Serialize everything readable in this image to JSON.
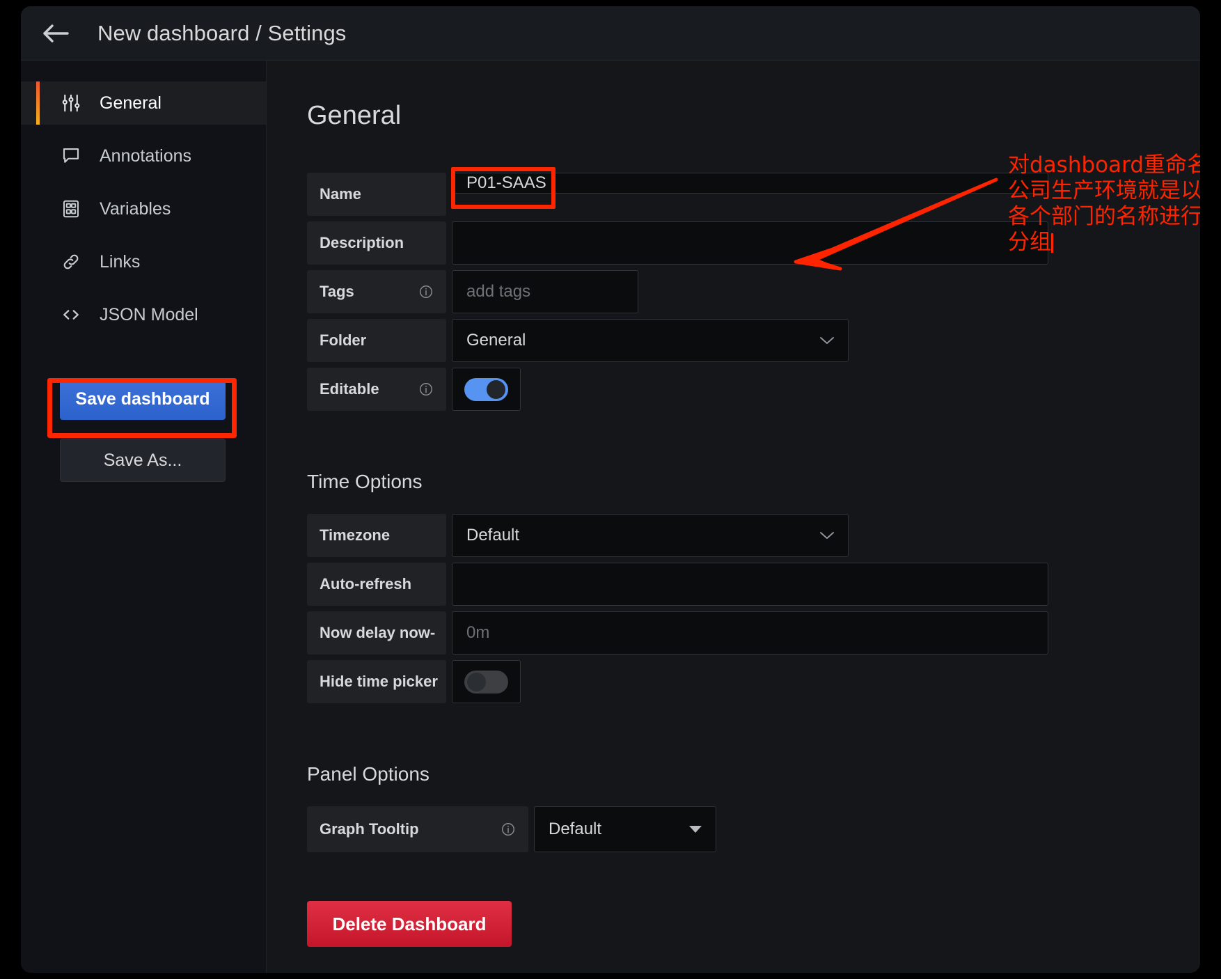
{
  "header": {
    "back_icon": "arrow-left-icon",
    "title": "New dashboard / Settings"
  },
  "sidebar": {
    "items": [
      {
        "label": "General",
        "icon": "sliders-icon",
        "active": true
      },
      {
        "label": "Annotations",
        "icon": "comment-icon",
        "active": false
      },
      {
        "label": "Variables",
        "icon": "calculator-icon",
        "active": false
      },
      {
        "label": "Links",
        "icon": "link-icon",
        "active": false
      },
      {
        "label": "JSON Model",
        "icon": "code-icon",
        "active": false
      }
    ],
    "save_button": "Save dashboard",
    "save_as_button": "Save As..."
  },
  "main": {
    "general": {
      "heading": "General",
      "name_label": "Name",
      "name_value": "P01-SAAS",
      "description_label": "Description",
      "description_value": "",
      "tags_label": "Tags",
      "tags_placeholder": "add tags",
      "tags_info_icon": "info-icon",
      "folder_label": "Folder",
      "folder_value": "General",
      "folder_chevron": "chevron-down-icon",
      "editable_label": "Editable",
      "editable_info_icon": "info-icon",
      "editable_on": true
    },
    "time_options": {
      "heading": "Time Options",
      "timezone_label": "Timezone",
      "timezone_value": "Default",
      "timezone_chevron": "chevron-down-icon",
      "auto_refresh_label": "Auto-refresh",
      "auto_refresh_value": "",
      "now_delay_label": "Now delay now-",
      "now_delay_placeholder": "0m",
      "hide_time_picker_label": "Hide time picker",
      "hide_time_picker_on": false
    },
    "panel_options": {
      "heading": "Panel Options",
      "graph_tooltip_label": "Graph Tooltip",
      "graph_tooltip_info_icon": "info-icon",
      "graph_tooltip_value": "Default",
      "graph_tooltip_caret": "caret-down-icon"
    },
    "delete_button": "Delete Dashboard"
  },
  "annotation": {
    "text": "对dashboard重命名\n公司生产环境就是以\n各个部门的名称进行\n分组",
    "arrow_icon": "red-arrow-icon",
    "color": "#ff2400",
    "highlight_color": "#fe2600"
  }
}
